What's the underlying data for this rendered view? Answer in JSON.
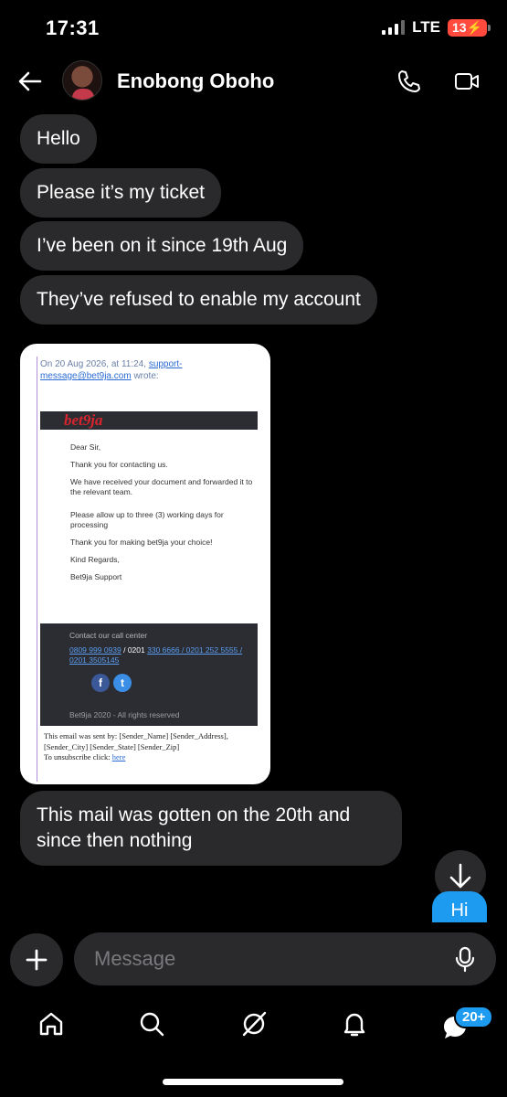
{
  "status": {
    "time": "17:31",
    "network": "LTE",
    "battery": "13"
  },
  "header": {
    "contact_name": "Enobong Oboho"
  },
  "messages": [
    "Hello",
    "Please it’s my ticket",
    "I’ve been on it since 19th Aug",
    "They’ve refused to enable my account"
  ],
  "email": {
    "wrote_prefix": "On 20 Aug 2026, at 11:24,",
    "wrote_link": "support-message@bet9ja.com",
    "wrote_suffix": "wrote:",
    "logo": "bet9ja",
    "greeting": "Dear Sir,",
    "thanks": "Thank you for contacting us.",
    "received": "We have received your document and forwarded it to the relevant team.",
    "allow": "Please allow up to three (3) working days for processing",
    "choice": "Thank you for making bet9ja your choice!",
    "regards": "Kind Regards,",
    "signature": "Bet9ja Support",
    "call_center": "Contact our call center",
    "phone1": "0809 999 0939",
    "phone_sep": "/ 0201",
    "phone2": "330 6666 / 0201 252 5555 / 0201 3505145",
    "rights": "Bet9ja 2020 - All rights reserved",
    "sent_by": "This email was sent by: [Sender_Name] [Sender_Address], [Sender_City] [Sender_State] [Sender_Zip]",
    "unsubscribe": "To unsubscribe click:",
    "unsubscribe_link": "here"
  },
  "message_after": "This mail was gotten on the 20th and since then nothing",
  "outgoing": "Hi",
  "composer": {
    "placeholder": "Message"
  },
  "nav": {
    "badge": "20+"
  },
  "colors": {
    "accent": "#1d9bf0",
    "bubble": "#2a2a2c",
    "battery": "#ff4a3d"
  }
}
